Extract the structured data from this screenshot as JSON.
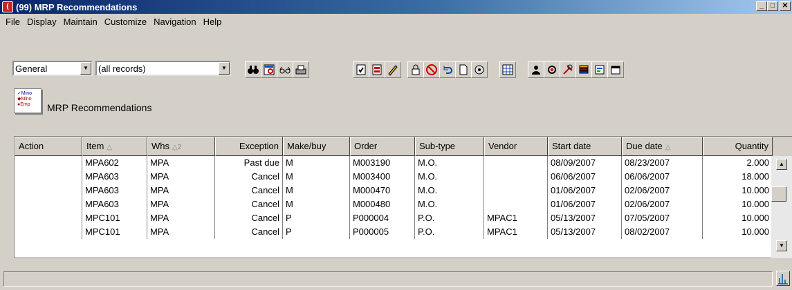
{
  "window": {
    "title": "(99) MRP Recommendations",
    "app_icon_letter": "("
  },
  "menu": [
    "File",
    "Display",
    "Maintain",
    "Customize",
    "Navigation",
    "Help"
  ],
  "toolbar": {
    "view_select": "General",
    "filter_select": "(all records)",
    "buttons": [
      "find-icon",
      "browse-icon",
      "glasses-icon",
      "print-icon",
      "checklist-icon",
      "report-icon",
      "edit-icon",
      "lock-icon",
      "cancel-icon",
      "undo-icon",
      "new-document-icon",
      "detail-icon",
      "grid-icon",
      "user-action-icon",
      "settings-icon",
      "tools-icon",
      "stack-icon",
      "export-icon",
      "calendar-icon"
    ]
  },
  "page": {
    "title": "MRP Recommendations",
    "icon_lines": [
      "✓Mino",
      "◆Mino",
      "●Emp"
    ]
  },
  "grid": {
    "columns": [
      {
        "key": "action",
        "label": "Action",
        "sort": ""
      },
      {
        "key": "item",
        "label": "Item",
        "sort": "△"
      },
      {
        "key": "whs",
        "label": "Whs",
        "sort": "△2"
      },
      {
        "key": "exception",
        "label": "Exception",
        "sort": ""
      },
      {
        "key": "make_buy",
        "label": "Make/buy",
        "sort": ""
      },
      {
        "key": "order",
        "label": "Order",
        "sort": ""
      },
      {
        "key": "sub_type",
        "label": "Sub-type",
        "sort": ""
      },
      {
        "key": "vendor",
        "label": "Vendor",
        "sort": ""
      },
      {
        "key": "start_date",
        "label": "Start date",
        "sort": ""
      },
      {
        "key": "due_date",
        "label": "Due date",
        "sort": "△"
      },
      {
        "key": "quantity",
        "label": "Quantity",
        "sort": ""
      }
    ],
    "rows": [
      {
        "action": "",
        "item": "MPA602",
        "whs": "MPA",
        "exception": "Past due",
        "make_buy": "M",
        "order": "M003190",
        "sub_type": "M.O.",
        "vendor": "",
        "start_date": "08/09/2007",
        "due_date": "08/23/2007",
        "quantity": "2.000"
      },
      {
        "action": "",
        "item": "MPA603",
        "whs": "MPA",
        "exception": "Cancel",
        "make_buy": "M",
        "order": "M003400",
        "sub_type": "M.O.",
        "vendor": "",
        "start_date": "06/06/2007",
        "due_date": "06/06/2007",
        "quantity": "18.000"
      },
      {
        "action": "",
        "item": "MPA603",
        "whs": "MPA",
        "exception": "Cancel",
        "make_buy": "M",
        "order": "M000470",
        "sub_type": "M.O.",
        "vendor": "",
        "start_date": "01/06/2007",
        "due_date": "02/06/2007",
        "quantity": "10.000"
      },
      {
        "action": "",
        "item": "MPA603",
        "whs": "MPA",
        "exception": "Cancel",
        "make_buy": "M",
        "order": "M000480",
        "sub_type": "M.O.",
        "vendor": "",
        "start_date": "01/06/2007",
        "due_date": "02/06/2007",
        "quantity": "10.000"
      },
      {
        "action": "",
        "item": "MPC101",
        "whs": "MPA",
        "exception": "Cancel",
        "make_buy": "P",
        "order": "P000004",
        "sub_type": "P.O.",
        "vendor": "MPAC1",
        "start_date": "05/13/2007",
        "due_date": "07/05/2007",
        "quantity": "10.000"
      },
      {
        "action": "",
        "item": "MPC101",
        "whs": "MPA",
        "exception": "Cancel",
        "make_buy": "P",
        "order": "P000005",
        "sub_type": "P.O.",
        "vendor": "MPAC1",
        "start_date": "05/13/2007",
        "due_date": "08/02/2007",
        "quantity": "10.000"
      }
    ]
  },
  "status": {
    "text": ""
  }
}
